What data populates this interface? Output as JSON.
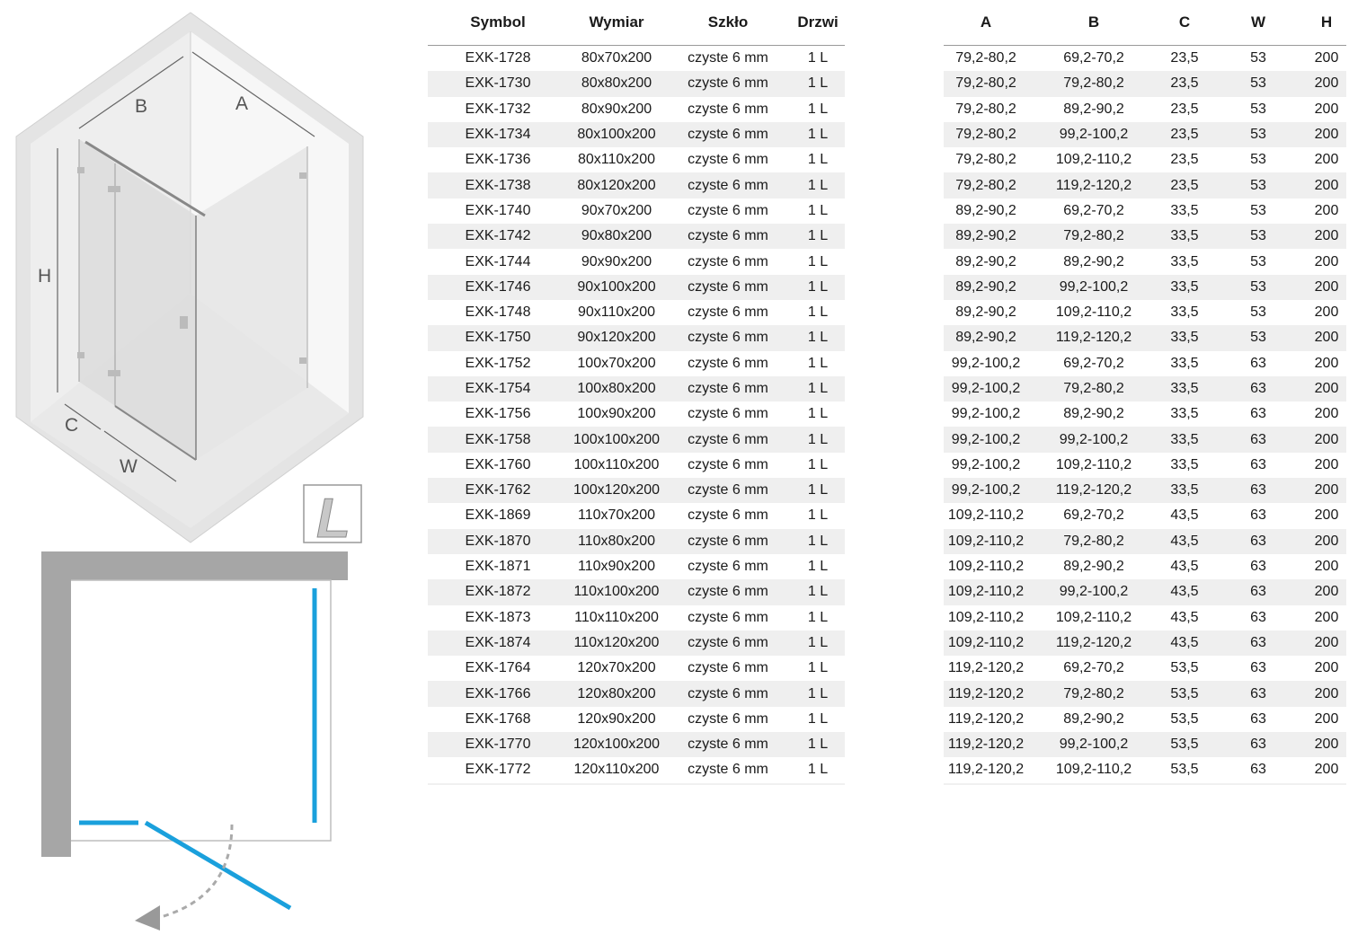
{
  "diagram": {
    "labels": {
      "a": "A",
      "b": "B",
      "h": "H",
      "c": "C",
      "w": "W"
    },
    "door_side_badge": "L"
  },
  "colors": {
    "glass_line": "#1aa0dc",
    "wall": "#a6a6a6",
    "row_stripe": "#efefef"
  },
  "icons": [
    "shower-cabin-isometric-icon",
    "door-left-badge-icon",
    "floor-plan-icon",
    "door-swing-arrow-icon"
  ],
  "table_left": {
    "headers": [
      "Symbol",
      "Wymiar",
      "Szkło",
      "Drzwi"
    ],
    "rows": [
      [
        "EXK-1728",
        "80x70x200",
        "czyste 6 mm",
        "1 L"
      ],
      [
        "EXK-1730",
        "80x80x200",
        "czyste 6 mm",
        "1 L"
      ],
      [
        "EXK-1732",
        "80x90x200",
        "czyste 6 mm",
        "1 L"
      ],
      [
        "EXK-1734",
        "80x100x200",
        "czyste 6 mm",
        "1 L"
      ],
      [
        "EXK-1736",
        "80x110x200",
        "czyste 6 mm",
        "1 L"
      ],
      [
        "EXK-1738",
        "80x120x200",
        "czyste 6 mm",
        "1 L"
      ],
      [
        "EXK-1740",
        "90x70x200",
        "czyste 6 mm",
        "1 L"
      ],
      [
        "EXK-1742",
        "90x80x200",
        "czyste 6 mm",
        "1 L"
      ],
      [
        "EXK-1744",
        "90x90x200",
        "czyste 6 mm",
        "1 L"
      ],
      [
        "EXK-1746",
        "90x100x200",
        "czyste 6 mm",
        "1 L"
      ],
      [
        "EXK-1748",
        "90x110x200",
        "czyste 6 mm",
        "1 L"
      ],
      [
        "EXK-1750",
        "90x120x200",
        "czyste 6 mm",
        "1 L"
      ],
      [
        "EXK-1752",
        "100x70x200",
        "czyste 6 mm",
        "1 L"
      ],
      [
        "EXK-1754",
        "100x80x200",
        "czyste 6 mm",
        "1 L"
      ],
      [
        "EXK-1756",
        "100x90x200",
        "czyste 6 mm",
        "1 L"
      ],
      [
        "EXK-1758",
        "100x100x200",
        "czyste 6 mm",
        "1 L"
      ],
      [
        "EXK-1760",
        "100x110x200",
        "czyste 6 mm",
        "1 L"
      ],
      [
        "EXK-1762",
        "100x120x200",
        "czyste 6 mm",
        "1 L"
      ],
      [
        "EXK-1869",
        "110x70x200",
        "czyste 6 mm",
        "1 L"
      ],
      [
        "EXK-1870",
        "110x80x200",
        "czyste 6 mm",
        "1 L"
      ],
      [
        "EXK-1871",
        "110x90x200",
        "czyste 6 mm",
        "1 L"
      ],
      [
        "EXK-1872",
        "110x100x200",
        "czyste 6 mm",
        "1 L"
      ],
      [
        "EXK-1873",
        "110x110x200",
        "czyste 6 mm",
        "1 L"
      ],
      [
        "EXK-1874",
        "110x120x200",
        "czyste 6 mm",
        "1 L"
      ],
      [
        "EXK-1764",
        "120x70x200",
        "czyste 6 mm",
        "1 L"
      ],
      [
        "EXK-1766",
        "120x80x200",
        "czyste 6 mm",
        "1 L"
      ],
      [
        "EXK-1768",
        "120x90x200",
        "czyste 6 mm",
        "1 L"
      ],
      [
        "EXK-1770",
        "120x100x200",
        "czyste 6 mm",
        "1 L"
      ],
      [
        "EXK-1772",
        "120x110x200",
        "czyste 6 mm",
        "1 L"
      ]
    ]
  },
  "table_right": {
    "headers": [
      "A",
      "B",
      "C",
      "W",
      "H"
    ],
    "rows": [
      [
        "79,2-80,2",
        "69,2-70,2",
        "23,5",
        "53",
        "200"
      ],
      [
        "79,2-80,2",
        "79,2-80,2",
        "23,5",
        "53",
        "200"
      ],
      [
        "79,2-80,2",
        "89,2-90,2",
        "23,5",
        "53",
        "200"
      ],
      [
        "79,2-80,2",
        "99,2-100,2",
        "23,5",
        "53",
        "200"
      ],
      [
        "79,2-80,2",
        "109,2-110,2",
        "23,5",
        "53",
        "200"
      ],
      [
        "79,2-80,2",
        "119,2-120,2",
        "23,5",
        "53",
        "200"
      ],
      [
        "89,2-90,2",
        "69,2-70,2",
        "33,5",
        "53",
        "200"
      ],
      [
        "89,2-90,2",
        "79,2-80,2",
        "33,5",
        "53",
        "200"
      ],
      [
        "89,2-90,2",
        "89,2-90,2",
        "33,5",
        "53",
        "200"
      ],
      [
        "89,2-90,2",
        "99,2-100,2",
        "33,5",
        "53",
        "200"
      ],
      [
        "89,2-90,2",
        "109,2-110,2",
        "33,5",
        "53",
        "200"
      ],
      [
        "89,2-90,2",
        "119,2-120,2",
        "33,5",
        "53",
        "200"
      ],
      [
        "99,2-100,2",
        "69,2-70,2",
        "33,5",
        "63",
        "200"
      ],
      [
        "99,2-100,2",
        "79,2-80,2",
        "33,5",
        "63",
        "200"
      ],
      [
        "99,2-100,2",
        "89,2-90,2",
        "33,5",
        "63",
        "200"
      ],
      [
        "99,2-100,2",
        "99,2-100,2",
        "33,5",
        "63",
        "200"
      ],
      [
        "99,2-100,2",
        "109,2-110,2",
        "33,5",
        "63",
        "200"
      ],
      [
        "99,2-100,2",
        "119,2-120,2",
        "33,5",
        "63",
        "200"
      ],
      [
        "109,2-110,2",
        "69,2-70,2",
        "43,5",
        "63",
        "200"
      ],
      [
        "109,2-110,2",
        "79,2-80,2",
        "43,5",
        "63",
        "200"
      ],
      [
        "109,2-110,2",
        "89,2-90,2",
        "43,5",
        "63",
        "200"
      ],
      [
        "109,2-110,2",
        "99,2-100,2",
        "43,5",
        "63",
        "200"
      ],
      [
        "109,2-110,2",
        "109,2-110,2",
        "43,5",
        "63",
        "200"
      ],
      [
        "109,2-110,2",
        "119,2-120,2",
        "43,5",
        "63",
        "200"
      ],
      [
        "119,2-120,2",
        "69,2-70,2",
        "53,5",
        "63",
        "200"
      ],
      [
        "119,2-120,2",
        "79,2-80,2",
        "53,5",
        "63",
        "200"
      ],
      [
        "119,2-120,2",
        "89,2-90,2",
        "53,5",
        "63",
        "200"
      ],
      [
        "119,2-120,2",
        "99,2-100,2",
        "53,5",
        "63",
        "200"
      ],
      [
        "119,2-120,2",
        "109,2-110,2",
        "53,5",
        "63",
        "200"
      ]
    ]
  }
}
